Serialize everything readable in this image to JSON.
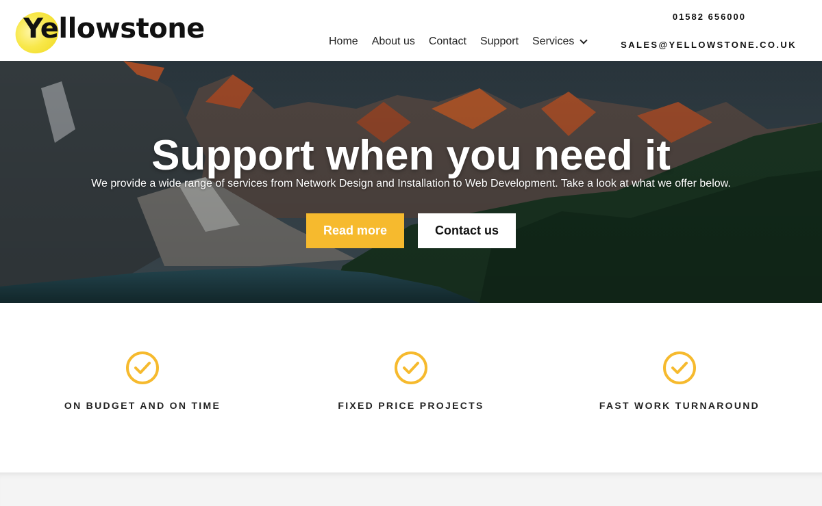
{
  "brand": {
    "name": "Yellowstone",
    "logo_color": "#f8e84b"
  },
  "nav": {
    "items": [
      {
        "label": "Home"
      },
      {
        "label": "About us"
      },
      {
        "label": "Contact"
      },
      {
        "label": "Support"
      },
      {
        "label": "Services",
        "icon": "chevron-down-icon"
      }
    ]
  },
  "contact": {
    "phone": "01582 656000",
    "email": "SALES@YELLOWSTONE.CO.UK"
  },
  "hero": {
    "title": "Support when you need it",
    "subtitle": "We provide a wide range of services from Network Design and Installation to Web Development. Take a look at what we offer below.",
    "primary_button": "Read more",
    "secondary_button": "Contact us"
  },
  "features": [
    {
      "label": "ON BUDGET AND ON TIME",
      "icon": "check-circle-icon"
    },
    {
      "label": "FIXED PRICE PROJECTS",
      "icon": "check-circle-icon"
    },
    {
      "label": "FAST WORK TURNAROUND",
      "icon": "check-circle-icon"
    }
  ],
  "colors": {
    "accent": "#f6ba2e",
    "text": "#222222",
    "hero_overlay": "#1c2a2e"
  }
}
